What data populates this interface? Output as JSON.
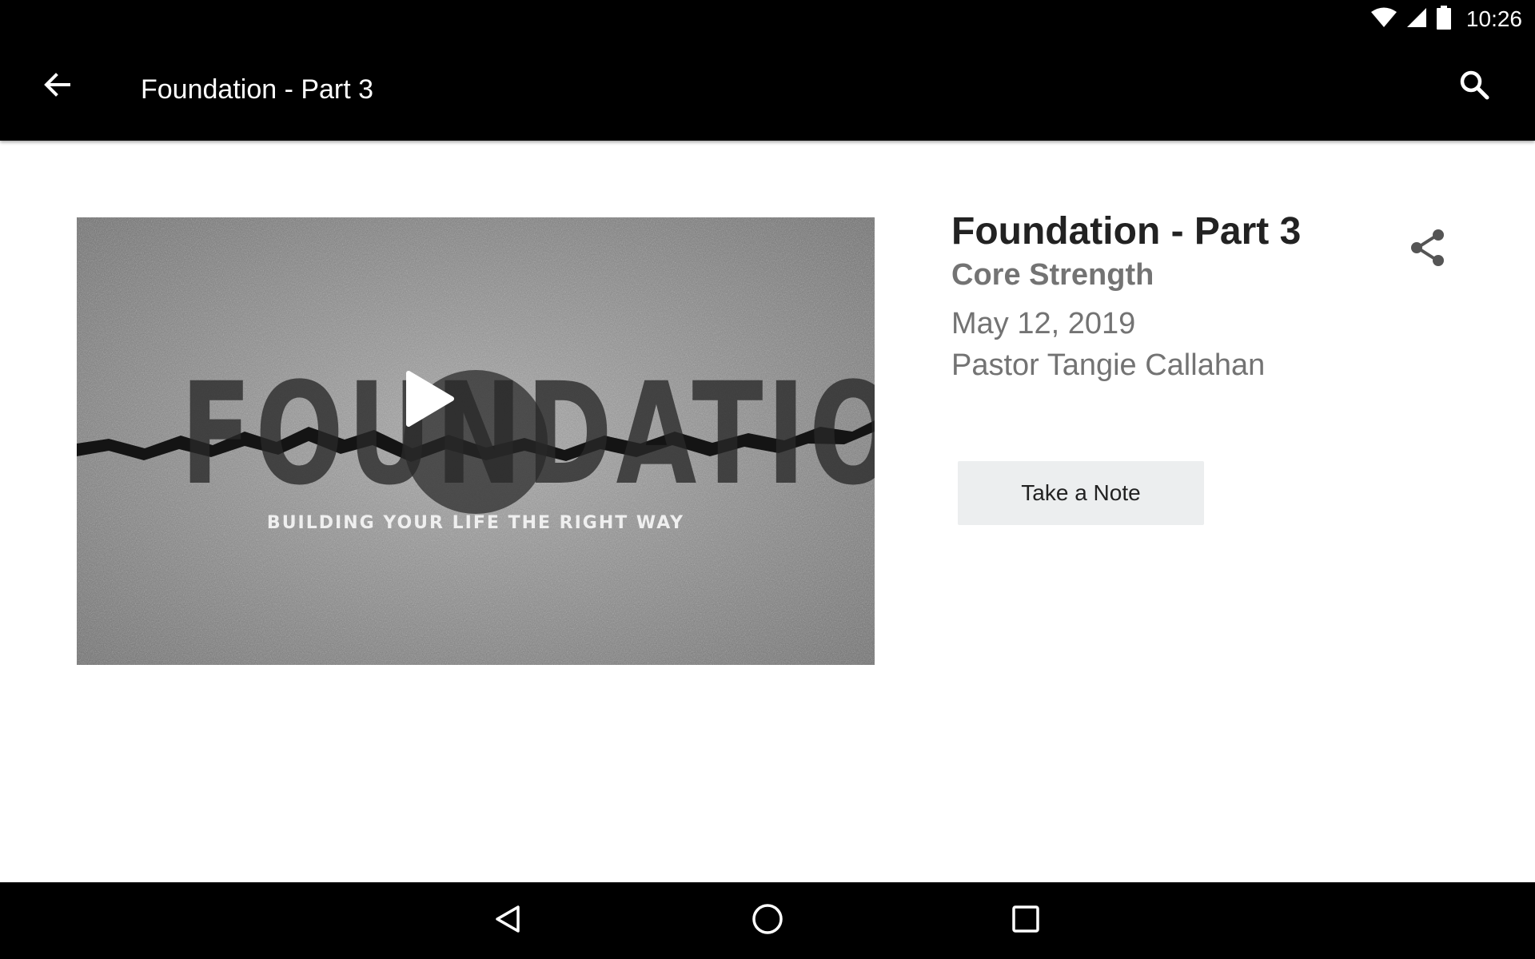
{
  "status_bar": {
    "time": "10:26",
    "icons": [
      "wifi-icon",
      "cell-signal-icon",
      "battery-icon"
    ]
  },
  "app_bar": {
    "title": "Foundation - Part 3",
    "back_icon": "arrow-left-icon",
    "search_icon": "search-icon"
  },
  "media": {
    "thumbnail_word": "FOUNDATION",
    "thumbnail_tagline": "BUILDING YOUR LIFE THE RIGHT WAY",
    "play_icon": "play-icon"
  },
  "sermon": {
    "title": "Foundation - Part 3",
    "series": "Core Strength",
    "date": "May 12, 2019",
    "speaker": "Pastor Tangie Callahan",
    "share_icon": "share-icon"
  },
  "actions": {
    "take_note_label": "Take a Note"
  },
  "nav_bar": {
    "icons": [
      "nav-back-icon",
      "nav-home-icon",
      "nav-recents-icon"
    ]
  },
  "colors": {
    "bars": "#000000",
    "title_text": "#222222",
    "secondary_text": "#737373",
    "button_bg": "#eceeef"
  }
}
